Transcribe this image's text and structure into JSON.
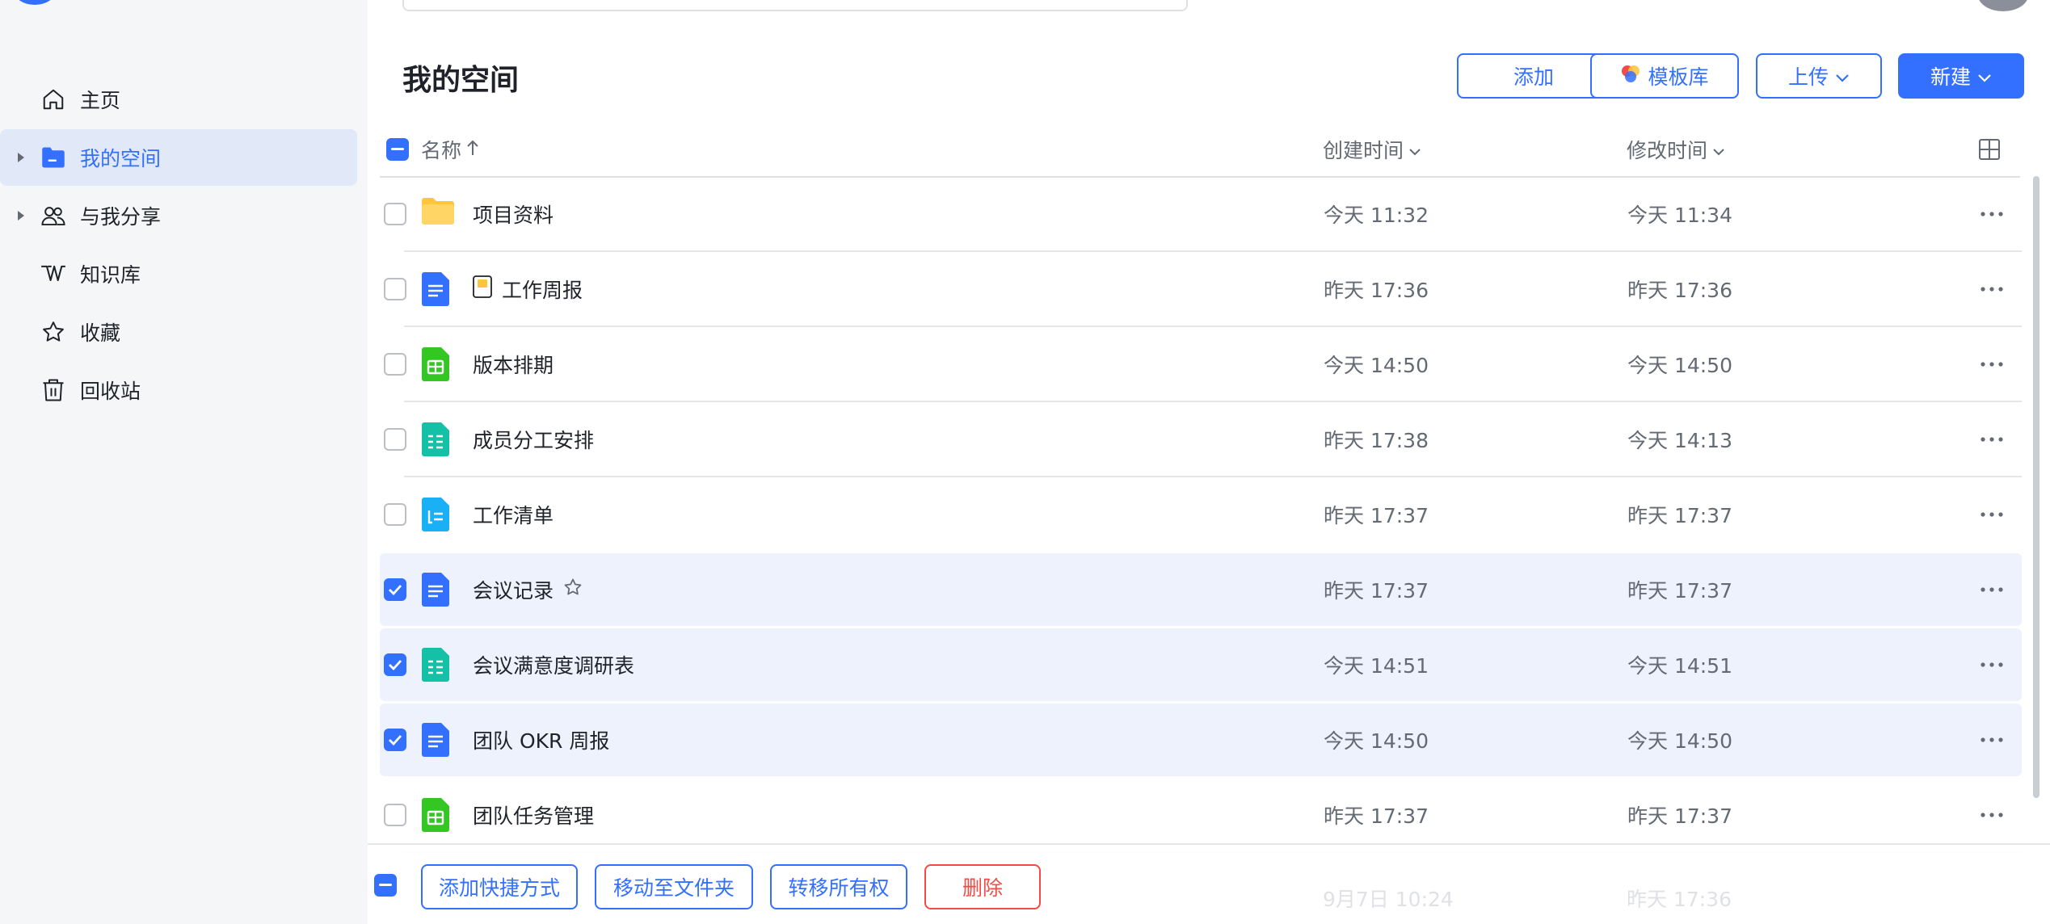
{
  "sidebar": {
    "items": [
      {
        "label": "主页",
        "icon": "home-icon"
      },
      {
        "label": "我的空间",
        "icon": "folder-icon",
        "active": true
      },
      {
        "label": "与我分享",
        "icon": "people-icon"
      },
      {
        "label": "知识库",
        "icon": "wiki-icon"
      },
      {
        "label": "收藏",
        "icon": "star-icon"
      },
      {
        "label": "回收站",
        "icon": "trash-icon"
      }
    ]
  },
  "header": {
    "title": "我的空间",
    "buttons": {
      "add": "添加",
      "templates": "模板库",
      "upload": "上传",
      "new": "新建"
    }
  },
  "table": {
    "columns": {
      "name": "名称",
      "created": "创建时间",
      "modified": "修改时间"
    },
    "rows": [
      {
        "name": "项目资料",
        "type": "folder",
        "created": "今天 11:32",
        "modified": "今天 11:34",
        "checked": false
      },
      {
        "name": "工作周报",
        "type": "doc",
        "created": "昨天 17:36",
        "modified": "昨天 17:36",
        "checked": false,
        "emoji": "notebook"
      },
      {
        "name": "版本排期",
        "type": "sheet",
        "created": "今天 14:50",
        "modified": "今天 14:50",
        "checked": false
      },
      {
        "name": "成员分工安排",
        "type": "form",
        "created": "昨天 17:38",
        "modified": "今天 14:13",
        "checked": false
      },
      {
        "name": "工作清单",
        "type": "list",
        "created": "昨天 17:37",
        "modified": "昨天 17:37",
        "checked": false
      },
      {
        "name": "会议记录",
        "type": "doc",
        "created": "昨天 17:37",
        "modified": "昨天 17:37",
        "checked": true,
        "starred": true
      },
      {
        "name": "会议满意度调研表",
        "type": "form",
        "created": "今天 14:51",
        "modified": "今天 14:51",
        "checked": true
      },
      {
        "name": "团队 OKR 周报",
        "type": "doc",
        "created": "今天 14:50",
        "modified": "今天 14:50",
        "checked": true
      },
      {
        "name": "团队任务管理",
        "type": "sheet",
        "created": "昨天 17:37",
        "modified": "昨天 17:37",
        "checked": false
      }
    ],
    "ghost_row": {
      "created": "9月7日 10:24",
      "modified": "昨天 17:36"
    }
  },
  "actions": {
    "shortcut": "添加快捷方式",
    "move": "移动至文件夹",
    "transfer": "转移所有权",
    "delete": "删除"
  },
  "colors": {
    "accent": "#3370ff",
    "danger": "#f54a45",
    "folder": "#ffc53d",
    "doc": "#3370ff",
    "sheet": "#34c724",
    "form": "#14c0a6",
    "list": "#19b0f5"
  }
}
